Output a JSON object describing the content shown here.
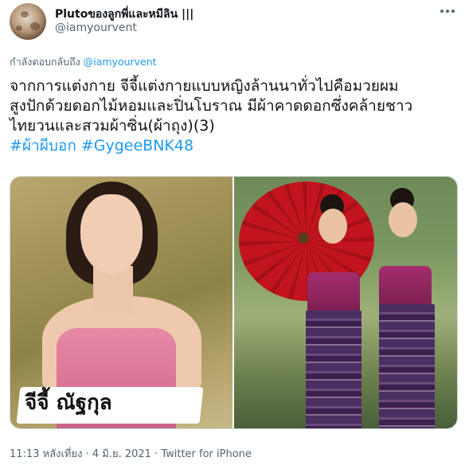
{
  "author": {
    "display_name": "Plutoของลูกพี่และหมีลิน |||",
    "handle": "@iamyourvent"
  },
  "reply_context": {
    "prefix": "กำลังตอบกลับถึง",
    "mention": "@iamyourvent"
  },
  "tweet": {
    "lines": [
      "จากการแต่งกาย จีจี้แต่งกายแบบหญิงล้านนาทั่วไปคือมวยผม",
      "สูงปักด้วยดอกไม้หอมและปิ่นโบราณ มีผ้าคาดดอกซึ่งคล้ายชาว",
      "ไทยวนและสวมผ้าซิ่น(ผ้าถุง)(3)"
    ],
    "hashtags": [
      "#ผ้าผีบอก",
      "#GygeeBNK48"
    ]
  },
  "media": {
    "left_caption": "จีจี้ ณัฐกุล"
  },
  "footer": {
    "timestamp": "11:13 หลังเที่ยง · 4 มิ.ย. 2021 · Twitter for iPhone"
  },
  "icons": {
    "more": "more-options-icon",
    "avatar": "pluto-avatar"
  }
}
